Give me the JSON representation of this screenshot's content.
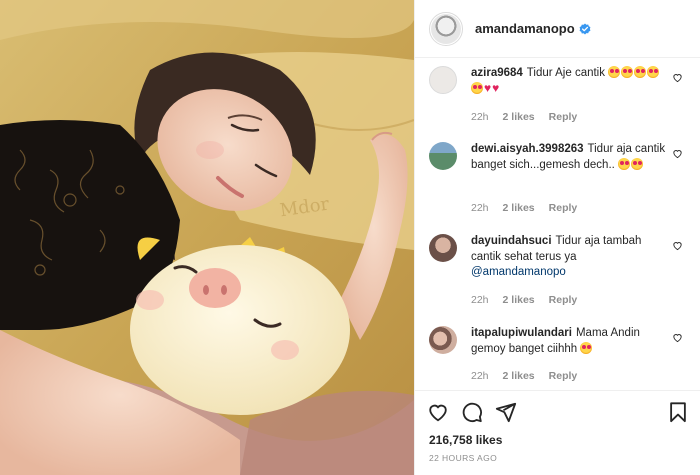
{
  "post": {
    "username": "amandamanopo",
    "verified": true,
    "likes_label": "216,758 likes",
    "time_ago": "22 HOURS AGO"
  },
  "photo": {
    "description_text": ""
  },
  "comments": [
    {
      "username": "azira9684",
      "text": "Tidur Aje cantik",
      "trailing_emojis": [
        "star-eyes",
        "star-eyes",
        "star-eyes",
        "star-eyes",
        "star-eyes",
        "heart",
        "heart"
      ],
      "time": "22h",
      "likes": "2 likes",
      "reply": "Reply",
      "avatar_color": "#ece9e6"
    },
    {
      "username": "dewi.aisyah.3998263",
      "text": "Tidur aja cantik banget sich...gemesh dech..",
      "trailing_emojis": [
        "star-eyes",
        "star-eyes"
      ],
      "time": "22h",
      "likes": "2 likes",
      "reply": "Reply",
      "avatar_color": "#5b8c6a"
    },
    {
      "username": "dayuindahsuci",
      "text": "Tidur aja tambah cantik sehat terus ya",
      "mention": "@amandamanopo",
      "time": "22h",
      "likes": "2 likes",
      "reply": "Reply",
      "avatar_color": "#a68a80"
    },
    {
      "username": "itapalupiwulandari",
      "text": "Mama Andin gemoy banget ciihhh",
      "trailing_emojis": [
        "star-eyes"
      ],
      "time": "22h",
      "likes": "2 likes",
      "reply": "Reply",
      "avatar_color": "#b98c7a"
    }
  ],
  "icons": {
    "like": "heart-outline-icon",
    "comment": "speech-bubble-icon",
    "share": "paper-plane-icon",
    "save": "bookmark-icon",
    "comment_like": "small-heart-icon"
  },
  "colors": {
    "text": "#262626",
    "muted": "#8e8e8e",
    "verified": "#3897f0",
    "link": "#00376b"
  }
}
